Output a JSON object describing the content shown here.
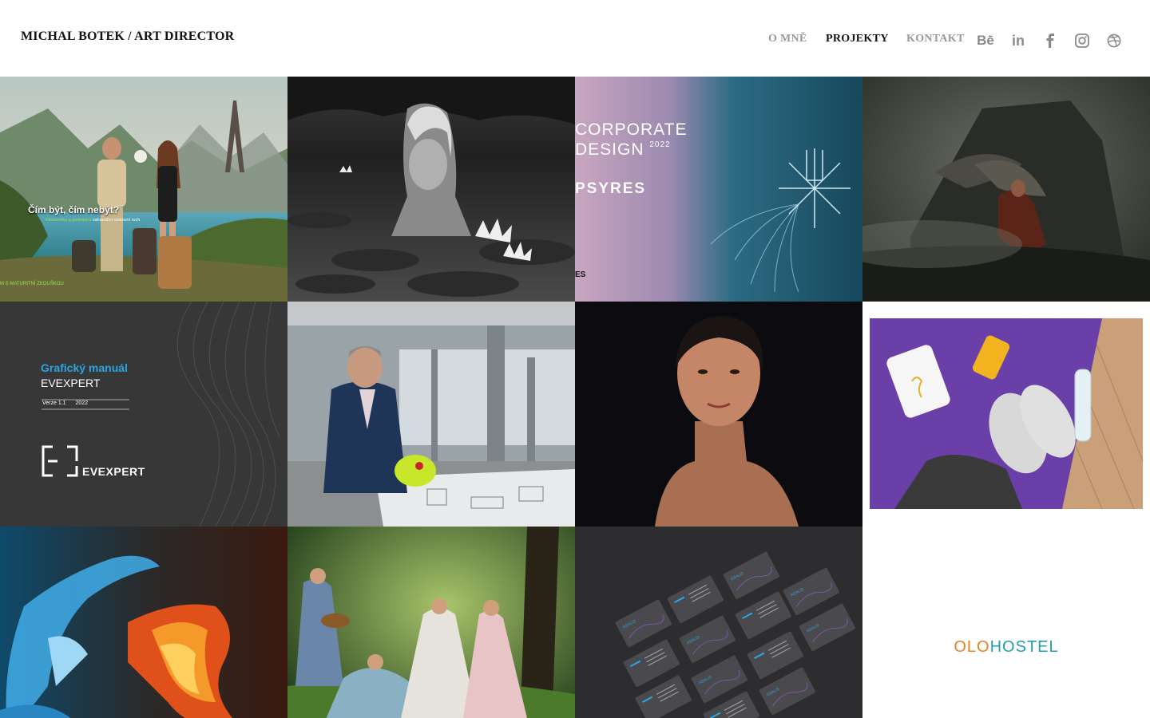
{
  "header": {
    "site_title": "MICHAL BOTEK / ART DIRECTOR",
    "nav": [
      {
        "label": "O MNĚ",
        "active": false
      },
      {
        "label": "PROJEKTY",
        "active": true
      },
      {
        "label": "KONTAKT",
        "active": false
      }
    ],
    "social": [
      {
        "icon": "behance-icon",
        "text": "Bē"
      },
      {
        "icon": "linkedin-icon",
        "text": "in"
      },
      {
        "icon": "facebook-icon"
      },
      {
        "icon": "instagram-icon"
      },
      {
        "icon": "dribbble-icon"
      }
    ],
    "nav_colors": {
      "active": "#111111",
      "inactive": "#999999",
      "icon": "#8a8a8a"
    }
  },
  "projects": [
    {
      "id": "travel",
      "caption": "Čím být, čím nebýt?",
      "subcaption_green": "Ekonomika a podnikání",
      "subcaption_white": "zahraniční cestovní ruch",
      "footer": "M S MATURITNÍ ZKOUŠKOU"
    },
    {
      "id": "waterlily"
    },
    {
      "id": "psyres",
      "line1": "CORPORATE",
      "line2": "DESIGN",
      "year": "2022",
      "brand": "PSYRES",
      "corner": "ES"
    },
    {
      "id": "angel"
    },
    {
      "id": "evexpert-manual",
      "title": "Grafický manuál",
      "brand": "EVEXPERT",
      "version": "Verze 1.1",
      "year": "2022",
      "logo_text": "EVEXPERT"
    },
    {
      "id": "businessman"
    },
    {
      "id": "portrait"
    },
    {
      "id": "fitness"
    },
    {
      "id": "fire-water"
    },
    {
      "id": "fairies"
    },
    {
      "id": "business-cards",
      "card_brand": "ASALIS"
    },
    {
      "id": "olo-hostel",
      "logo_part1": "OLO",
      "logo_part2": "HOSTEL"
    }
  ],
  "colors": {
    "accent_blue": "#2aa6e0",
    "olo_orange": "#e8801e",
    "olo_teal": "#1f9fb0",
    "dark_tile": "#2e2e2e",
    "green_text": "#9be15a"
  }
}
